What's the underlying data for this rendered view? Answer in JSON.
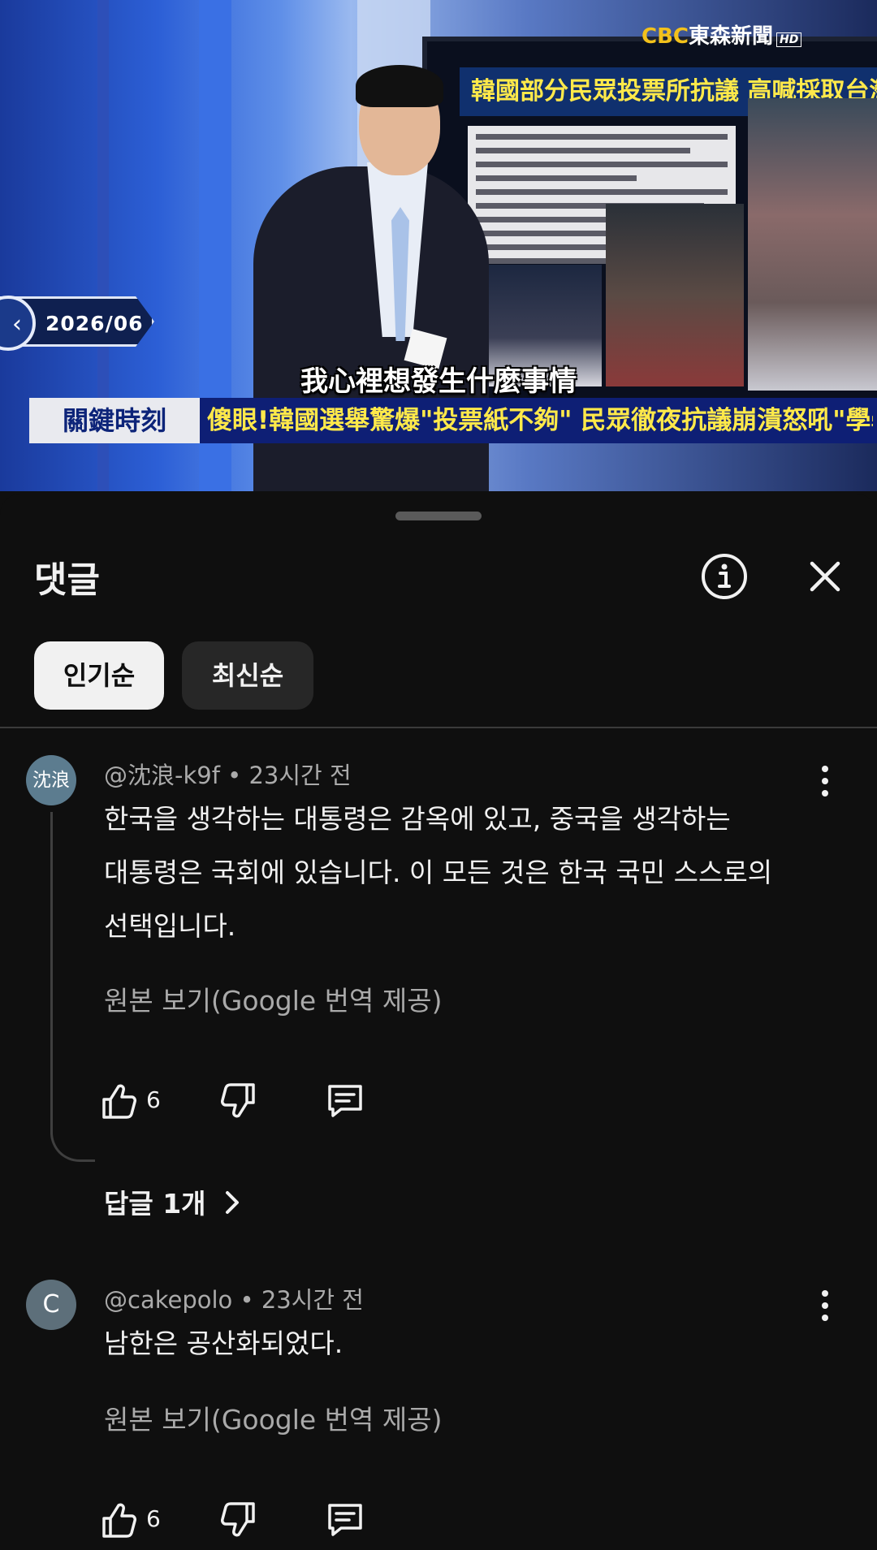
{
  "video": {
    "channel_logo_cbc": "CBC",
    "channel_logo_name": "東森新聞",
    "channel_logo_hd": "HD",
    "panel_headline": "韓國部分民眾投票所抗議  高喊採取台灣投",
    "date_tag": "2026/06",
    "subtitle": "我心裡想發生什麼事情",
    "program_label": "關鍵時刻",
    "headline": "傻眼!韓國選舉驚爆\"投票紙不夠\" 民眾徹夜抗議崩潰怒吼\"學學台灣\"!"
  },
  "sheet": {
    "title": "댓글",
    "info_icon": "info-icon",
    "close_icon": "close-icon",
    "sort_chips": [
      {
        "label": "인기순",
        "active": true
      },
      {
        "label": "최신순",
        "active": false
      }
    ]
  },
  "comments": [
    {
      "avatar_text": "沈浪",
      "avatar_color": "#5c7c8f",
      "author": "@沈浪-k9f",
      "time": "23시간 전",
      "lines": [
        "한국을 생각하는 대통령은 감옥에 있고, 중국을 생각하는",
        "대통령은 국회에 있습니다. 이 모든 것은 한국 국민 스스로의",
        "선택입니다."
      ],
      "translate_link": "원본 보기(Google 번역 제공)",
      "likes": "6",
      "replies_label": "답글 1개"
    },
    {
      "avatar_text": "C",
      "avatar_color": "#5d6f7a",
      "author": "@cakepolo",
      "time": "23시간 전",
      "lines": [
        "남한은 공산화되었다."
      ],
      "translate_link": "원본 보기(Google 번역 제공)",
      "likes": "6"
    }
  ],
  "colors": {
    "background": "#0f0f0f",
    "text_primary": "#f1f1f1",
    "text_secondary": "#aaaaaa",
    "chip_active_bg": "#f1f1f1",
    "chip_inactive_bg": "#272727"
  }
}
